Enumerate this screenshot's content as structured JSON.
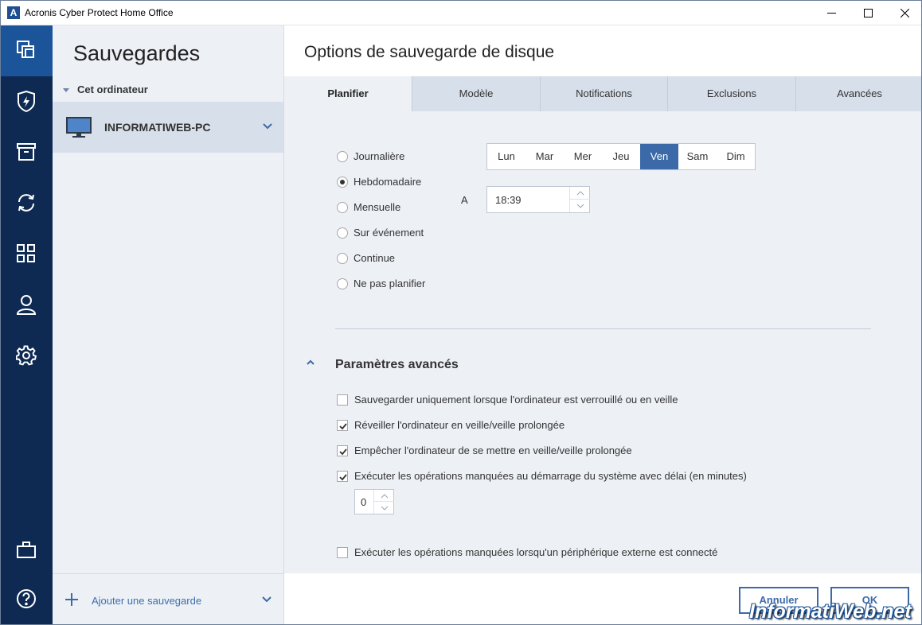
{
  "window": {
    "app_icon": "A",
    "title": "Acronis Cyber Protect Home Office"
  },
  "nav": [
    {
      "name": "backups-nav",
      "icon": "copy-icon"
    },
    {
      "name": "protection-nav",
      "icon": "shield-bolt-icon"
    },
    {
      "name": "archive-nav",
      "icon": "archive-box-icon"
    },
    {
      "name": "sync-nav",
      "icon": "sync-icon"
    },
    {
      "name": "tools-nav",
      "icon": "grid-icon"
    },
    {
      "name": "account-nav",
      "icon": "user-icon"
    },
    {
      "name": "settings-nav",
      "icon": "gear-icon"
    },
    {
      "name": "store-nav",
      "icon": "briefcase-icon"
    },
    {
      "name": "help-nav",
      "icon": "help-icon"
    }
  ],
  "backups": {
    "title": "Sauvegardes",
    "group_label": "Cet ordinateur",
    "machine_name": "INFORMATIWEB-PC",
    "add_label": "Ajouter une sauvegarde"
  },
  "main": {
    "title": "Options de sauvegarde de disque",
    "tabs": [
      "Planifier",
      "Modèle",
      "Notifications",
      "Exclusions",
      "Avancées"
    ],
    "active_tab": "Planifier",
    "schedule_options": [
      "Journalière",
      "Hebdomadaire",
      "Mensuelle",
      "Sur événement",
      "Continue",
      "Ne pas planifier"
    ],
    "selected_option": "Hebdomadaire",
    "days": [
      "Lun",
      "Mar",
      "Mer",
      "Jeu",
      "Ven",
      "Sam",
      "Dim"
    ],
    "selected_day": "Ven",
    "at_label": "A",
    "time": "18:39",
    "advanced_title": "Paramètres avancés",
    "advanced_options": [
      {
        "label": "Sauvegarder uniquement lorsque l'ordinateur est verrouillé ou en veille",
        "checked": false
      },
      {
        "label": "Réveiller l'ordinateur en veille/veille prolongée",
        "checked": true
      },
      {
        "label": "Empêcher l'ordinateur de se mettre en veille/veille prolongée",
        "checked": true
      },
      {
        "label": "Exécuter les opérations manquées au démarrage du système avec délai (en minutes)",
        "checked": true
      },
      {
        "label": "Exécuter les opérations manquées lorsqu'un périphérique externe est connecté",
        "checked": false
      }
    ],
    "delay_value": "0"
  },
  "footer": {
    "cancel_label": "Annuler",
    "ok_label": "OK"
  },
  "watermark": "InformatiWeb.net",
  "colors": {
    "nav_bg": "#0e2a52",
    "nav_active": "#1b5499",
    "accent": "#3c6aa8",
    "panel_bg": "#edf0f5"
  }
}
